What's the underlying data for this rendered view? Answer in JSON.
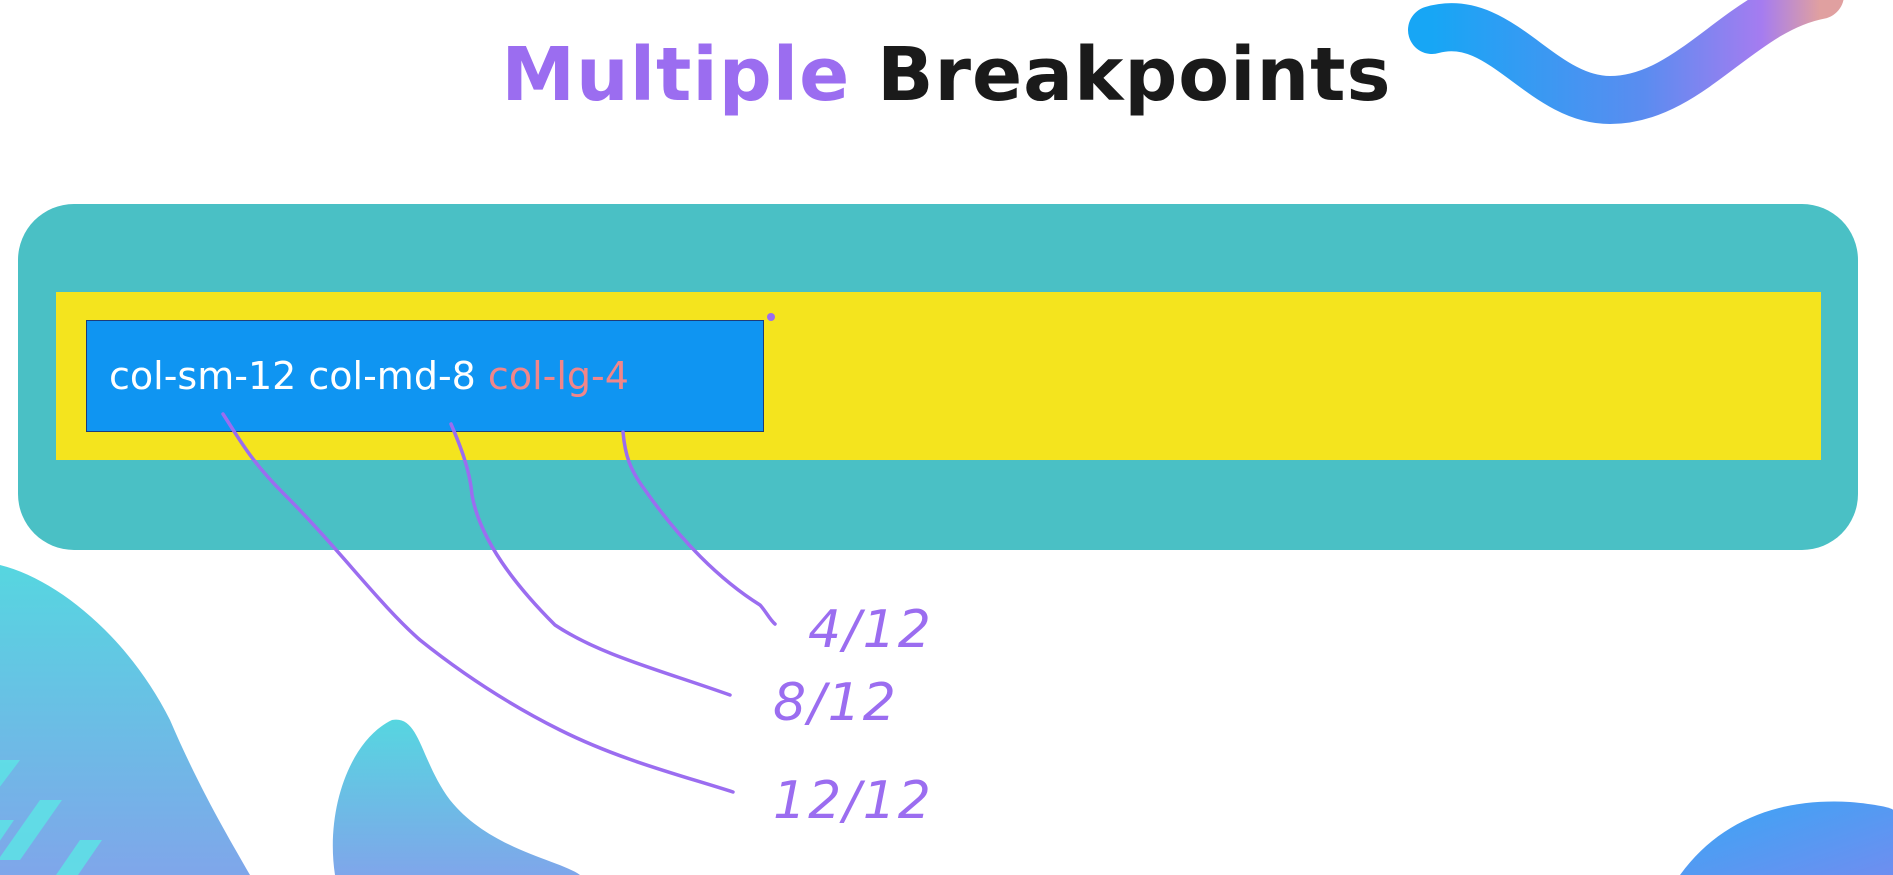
{
  "title": {
    "word1": "Multiple",
    "word2": "Breakpoints"
  },
  "column": {
    "class_sm": "col-sm-12",
    "class_md": "col-md-8",
    "class_lg": "col-lg-4"
  },
  "annotations": {
    "lg": "4/12",
    "md": "8/12",
    "sm": "12/12"
  },
  "colors": {
    "accent_purple": "#9b6df0",
    "container_teal": "#4ac0c5",
    "row_yellow": "#f4e41e",
    "column_blue": "#0f95f2",
    "highlight_salmon": "#f0868a"
  }
}
